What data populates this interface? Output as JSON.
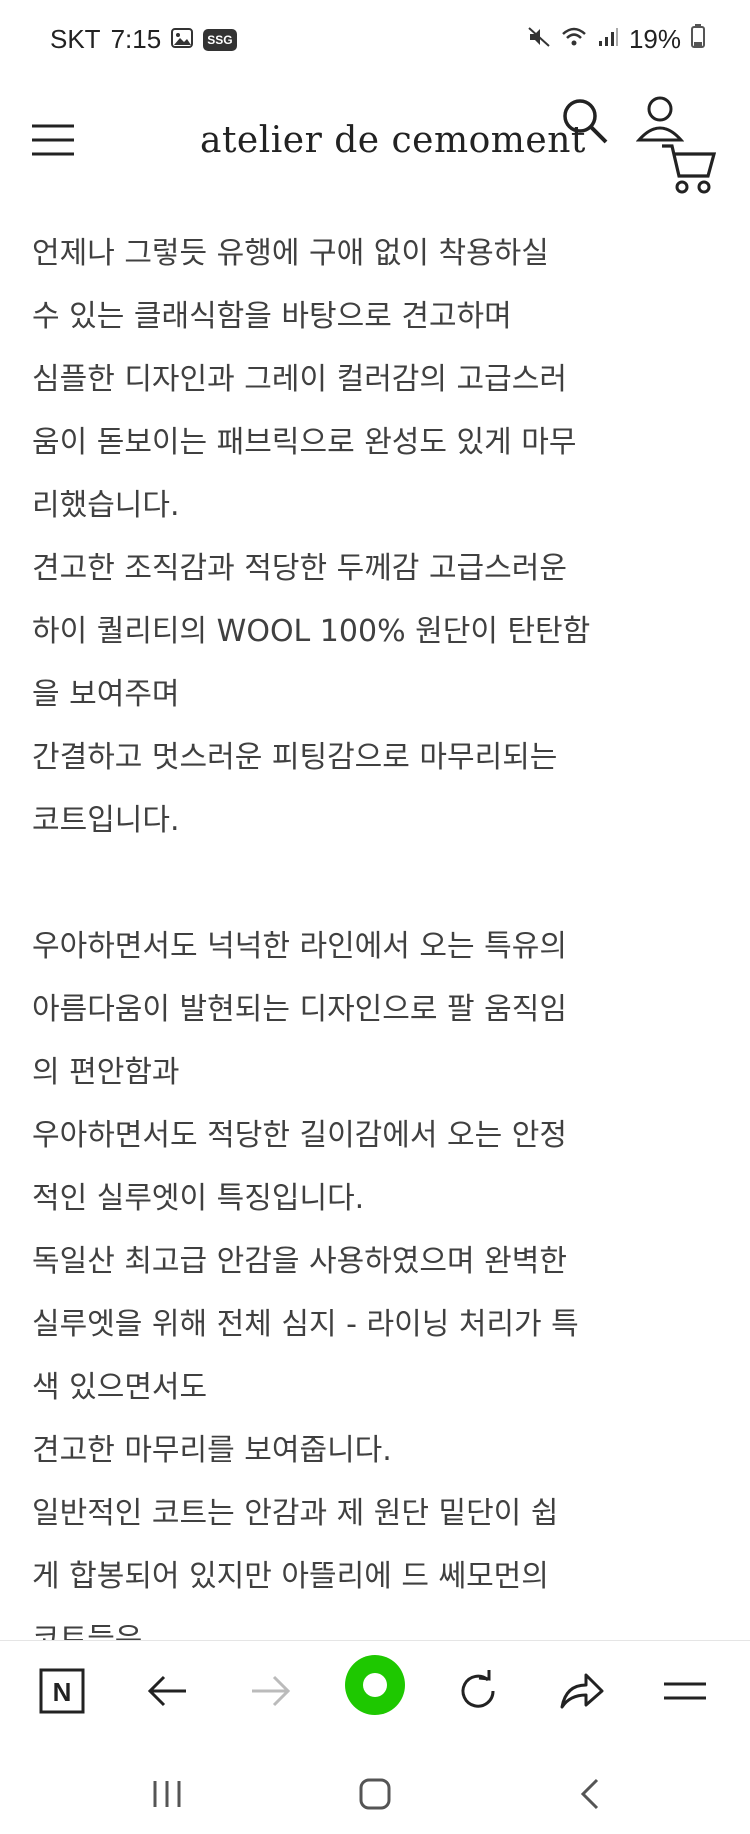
{
  "status_bar": {
    "carrier": "SKT",
    "time": "7:15",
    "ssg_badge": "SSG",
    "battery": "19%"
  },
  "header": {
    "brand": "atelier de cemoment",
    "icons": [
      "menu-icon",
      "search-icon",
      "user-icon",
      "cart-icon"
    ]
  },
  "content": {
    "lines": [
      "언제나 그렇듯 유행에 구애 없이 착용하실",
      "수 있는 클래식함을 바탕으로 견고하며",
      "심플한 디자인과 그레이 컬러감의 고급스러",
      "움이 돋보이는 패브릭으로 완성도 있게 마무",
      "리했습니다.",
      "견고한 조직감과 적당한 두께감 고급스러운",
      "하이 퀄리티의 WOOL 100% 원단이 탄탄함",
      "을 보여주며",
      "간결하고 멋스러운 피팅감으로 마무리되는",
      "코트입니다.",
      "",
      "우아하면서도 넉넉한 라인에서 오는 특유의",
      "아름다움이 발현되는 디자인으로 팔 움직임",
      "의 편안함과",
      "우아하면서도 적당한 길이감에서 오는 안정",
      "적인 실루엣이 특징입니다.",
      "독일산 최고급 안감을 사용하였으며 완벽한",
      "실루엣을 위해 전체 심지 - 라이닝 처리가 특",
      "색 있으면서도",
      "견고한 마무리를 보여줍니다.",
      "일반적인 코트는 안감과 제 원단 밑단이 쉽",
      "게 합봉되어 있지만 아뜰리에 드 쎄모먼의",
      "코트들은"
    ]
  },
  "browser_toolbar": {
    "items": [
      "naver-icon",
      "back-arrow-icon",
      "forward-arrow-icon",
      "home-green-icon",
      "refresh-icon",
      "share-icon",
      "menu-icon"
    ],
    "naver_label": "N"
  },
  "system_nav": {
    "items": [
      "recent-apps-icon",
      "home-icon",
      "back-icon"
    ]
  },
  "colors": {
    "green_accent": "#1ec800",
    "text": "#404040"
  }
}
